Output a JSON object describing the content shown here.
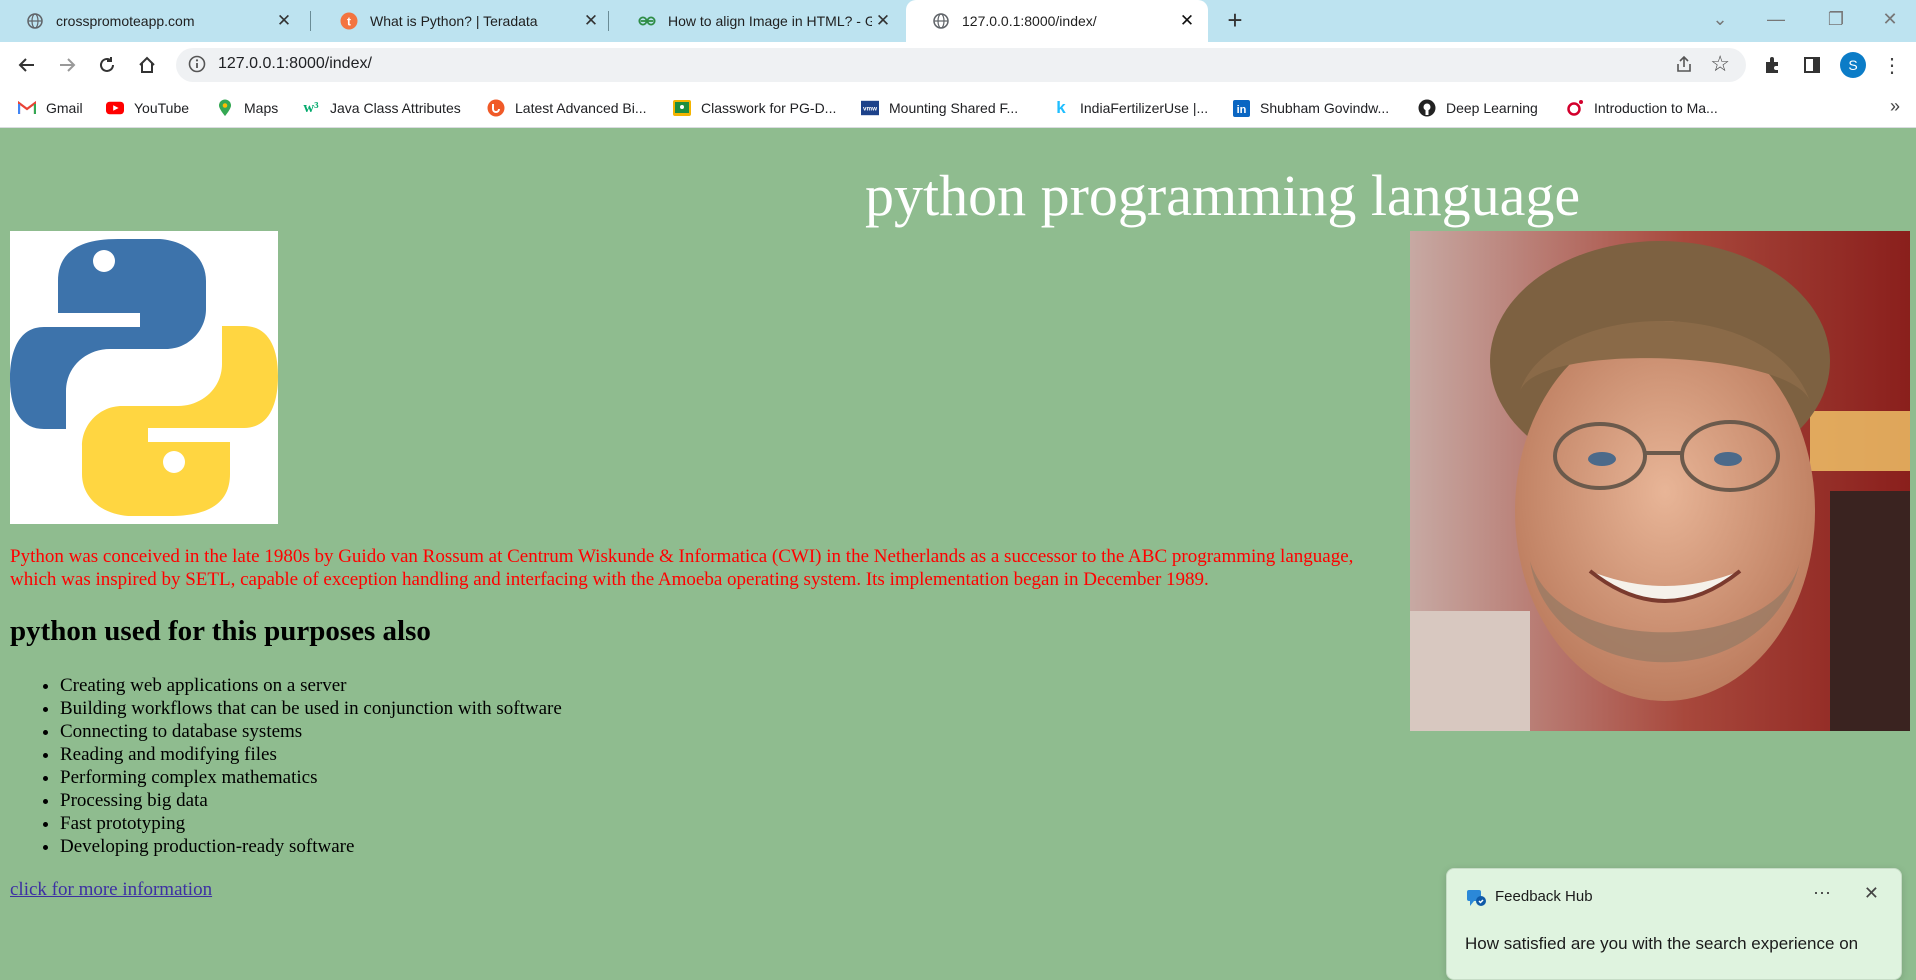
{
  "browser": {
    "tabs": [
      {
        "title": "crosspromoteapp.com",
        "icon": "globe-icon",
        "active": false
      },
      {
        "title": "What is Python? | Teradata",
        "icon": "teradata-icon",
        "active": false
      },
      {
        "title": "How to align Image in HTML? - G",
        "icon": "gfg-icon",
        "active": false
      },
      {
        "title": "127.0.0.1:8000/index/",
        "icon": "globe-icon",
        "active": true
      }
    ],
    "new_tab": "+",
    "url": "127.0.0.1:8000/index/",
    "profile_initial": "S",
    "bookmarks": [
      {
        "label": "Gmail",
        "icon": "gmail-icon",
        "color": "#ea4335"
      },
      {
        "label": "YouTube",
        "icon": "youtube-icon",
        "color": "#ff0000"
      },
      {
        "label": "Maps",
        "icon": "maps-icon",
        "color": "#34a853"
      },
      {
        "label": "Java Class Attributes",
        "icon": "w3schools-icon",
        "color": "#04aa6d"
      },
      {
        "label": "Latest Advanced Bi...",
        "icon": "bookmark-site-icon",
        "color": "#f05a28"
      },
      {
        "label": "Classwork for PG-D...",
        "icon": "classroom-icon",
        "color": "#f4b400"
      },
      {
        "label": "Mounting Shared F...",
        "icon": "vmware-icon",
        "color": "#1d428a"
      },
      {
        "label": "IndiaFertilizerUse |...",
        "icon": "kaggle-icon",
        "color": "#20beff"
      },
      {
        "label": "Shubham Govindw...",
        "icon": "linkedin-icon",
        "color": "#0a66c2"
      },
      {
        "label": "Deep Learning",
        "icon": "github-icon",
        "color": "#222222"
      },
      {
        "label": "Introduction to Ma...",
        "icon": "oreilly-icon",
        "color": "#d3002d"
      }
    ],
    "more": "»"
  },
  "page": {
    "heading": "python programming language",
    "intro": "Python was conceived in the late 1980s by Guido van Rossum at Centrum Wiskunde & Informatica (CWI) in the Netherlands as a successor to the ABC programming language, which was inspired by SETL, capable of exception handling and interfacing with the Amoeba operating system. Its implementation began in December 1989.",
    "subheading": "python used for this purposes also",
    "purposes": [
      "Creating web applications on a server",
      "Building workflows that can be used in conjunction with software",
      "Connecting to database systems",
      "Reading and modifying files",
      "Performing complex mathematics",
      "Processing big data",
      "Fast prototyping",
      "Developing production-ready software"
    ],
    "link": "click for more information",
    "colors": {
      "background": "#8fbc8f",
      "heading": "#ffffff",
      "intro": "#ff0000"
    }
  },
  "feedback": {
    "title": "Feedback Hub",
    "question": "How satisfied are you with the search experience on"
  }
}
